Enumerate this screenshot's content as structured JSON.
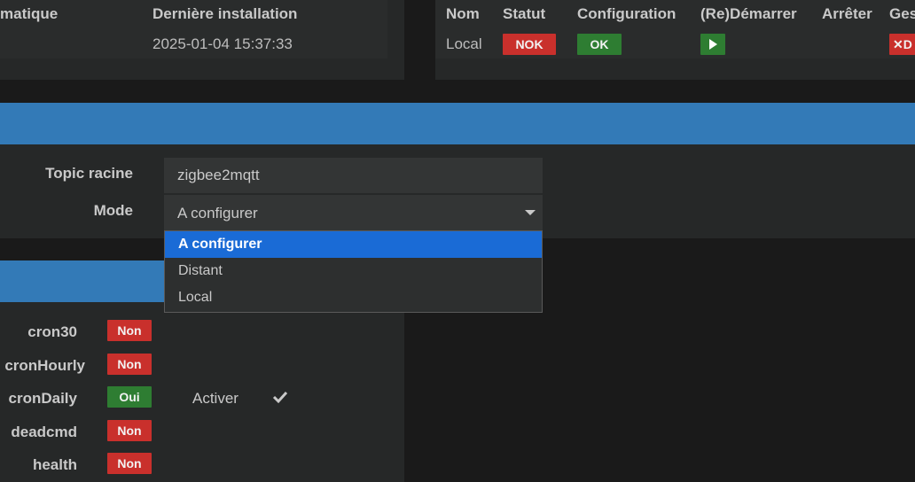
{
  "top_left": {
    "col1_header": "matique",
    "col2_header": "Dernière installation",
    "install_date": "2025-01-04 15:37:33"
  },
  "daemon": {
    "headers": {
      "nom": "Nom",
      "statut": "Statut",
      "configuration": "Configuration",
      "redemarrer": "(Re)Démarrer",
      "arreter": "Arrêter",
      "gestion": "Ges"
    },
    "row": {
      "nom": "Local",
      "statut": "NOK",
      "configuration": "OK",
      "stop_label": "D"
    }
  },
  "config": {
    "topic_label": "Topic racine",
    "topic_value": "zigbee2mqtt",
    "mode_label": "Mode",
    "mode_value": "A configurer",
    "mode_options": [
      "A configurer",
      "Distant",
      "Local"
    ]
  },
  "crons": {
    "items": [
      {
        "name": "cron30",
        "status": "Non"
      },
      {
        "name": "cronHourly",
        "status": "Non"
      },
      {
        "name": "cronDaily",
        "status": "Oui"
      },
      {
        "name": "deadcmd",
        "status": "Non"
      },
      {
        "name": "health",
        "status": "Non"
      }
    ],
    "activer_label": "Activer"
  },
  "colors": {
    "red": "#c9302c",
    "green": "#2e7d32",
    "blue": "#337ab7",
    "select_highlight": "#1a6bd6"
  },
  "icons": {
    "play": "play-icon",
    "close": "close-icon",
    "dropdown": "caret-down-icon",
    "check": "check-icon"
  }
}
